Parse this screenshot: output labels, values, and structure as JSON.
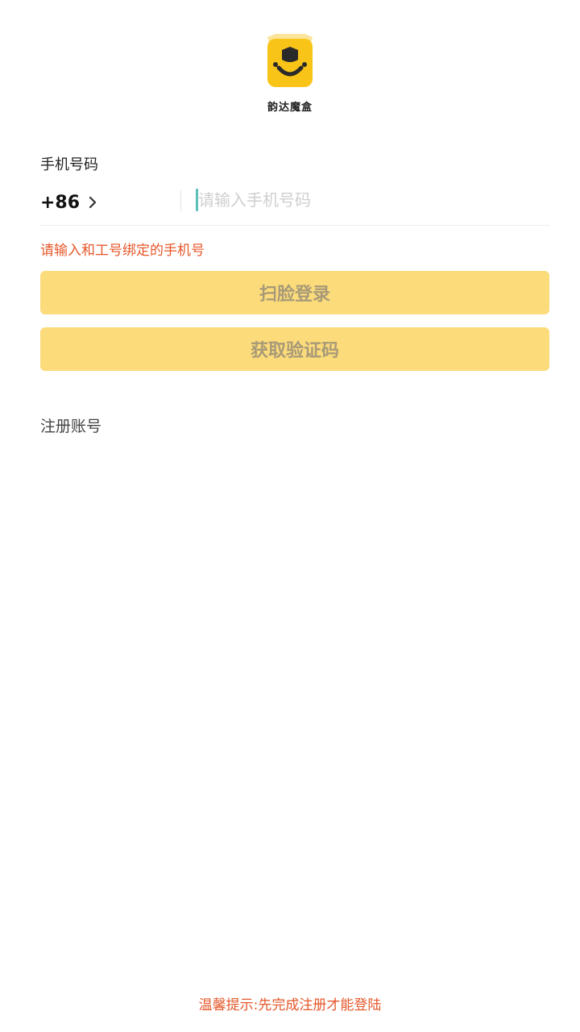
{
  "app": {
    "name": "韵达魔盒",
    "brand_color": "#f9c418"
  },
  "form": {
    "phone_label": "手机号码",
    "country_code": "+86",
    "phone_placeholder": "请输入手机号码",
    "phone_value": "",
    "hint": "请输入和工号绑定的手机号"
  },
  "buttons": {
    "face_login": "扫脸登录",
    "get_code": "获取验证码"
  },
  "links": {
    "register": "注册账号"
  },
  "footer": {
    "tip": "温馨提示:先完成注册才能登陆"
  },
  "colors": {
    "button_bg": "#fbdb7a",
    "button_text": "#a89a78",
    "warning": "#e5572a",
    "cursor": "#5cc0b8"
  },
  "icons": {
    "logo": "smiling-mascot-icon",
    "country_chevron": "chevron-right-icon"
  }
}
